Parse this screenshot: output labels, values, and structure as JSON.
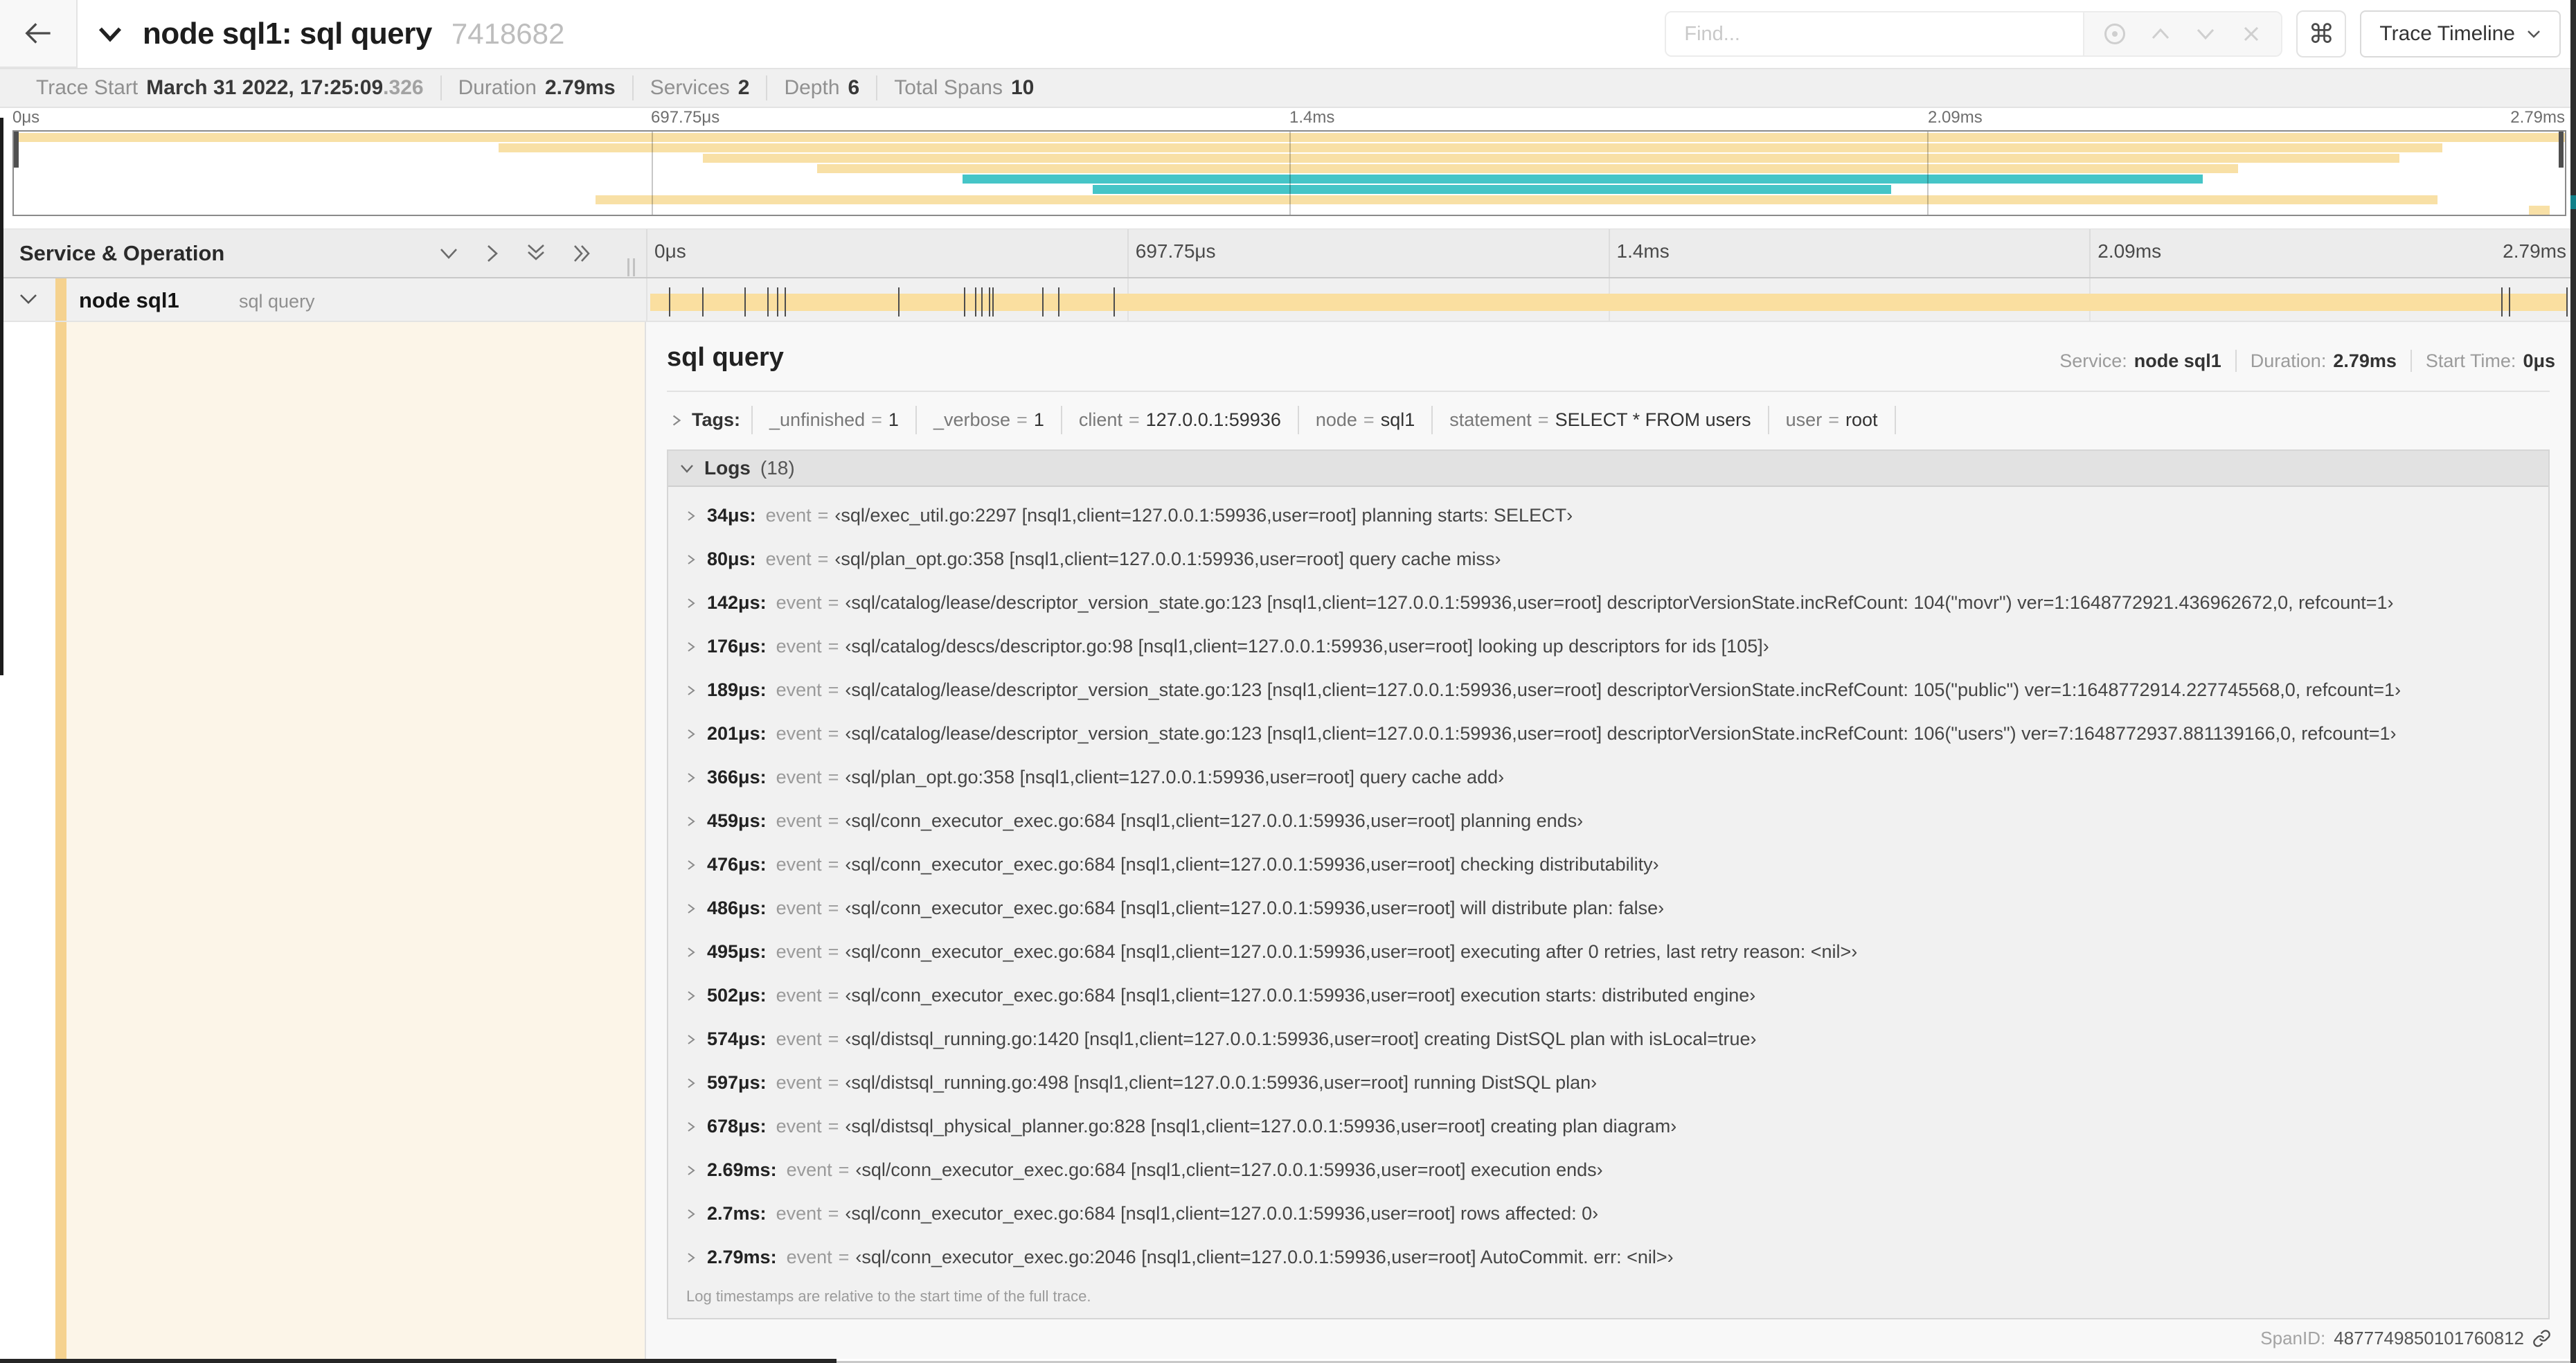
{
  "header": {
    "back_label": "back",
    "title": "node sql1: sql query",
    "trace_id": "7418682",
    "find_placeholder": "Find...",
    "shortcut_key": "⌘",
    "view_selector": "Trace Timeline"
  },
  "infobar": [
    {
      "label": "Trace Start",
      "value": "March 31 2022, 17:25:09",
      "suffix": ".326"
    },
    {
      "label": "Duration",
      "value": "2.79ms"
    },
    {
      "label": "Services",
      "value": "2"
    },
    {
      "label": "Depth",
      "value": "6"
    },
    {
      "label": "Total Spans",
      "value": "10"
    }
  ],
  "timeline": {
    "service_op_label": "Service & Operation",
    "ruler": [
      "0μs",
      "697.75μs",
      "1.4ms",
      "2.09ms",
      "2.79ms"
    ]
  },
  "minimap": {
    "bars": [
      {
        "s": 0,
        "e": 100,
        "c": "tan"
      },
      {
        "s": 19.0,
        "e": 95.2,
        "c": "tan"
      },
      {
        "s": 27.0,
        "e": 93.5,
        "c": "tan"
      },
      {
        "s": 31.5,
        "e": 87.2,
        "c": "tan"
      },
      {
        "s": 37.2,
        "e": 85.8,
        "c": "teal"
      },
      {
        "s": 42.3,
        "e": 73.6,
        "c": "teal"
      },
      {
        "s": 22.8,
        "e": 95.0,
        "c": "tan"
      },
      {
        "s": 98.6,
        "e": 99.4,
        "c": "tan"
      }
    ]
  },
  "span": {
    "service": "node sql1",
    "operation": "sql query",
    "ticks": [
      {
        "pct": 1.2
      },
      {
        "pct": 2.9
      },
      {
        "pct": 5.1
      },
      {
        "pct": 6.3
      },
      {
        "pct": 6.8
      },
      {
        "pct": 7.2
      },
      {
        "pct": 13.1
      },
      {
        "pct": 16.5
      },
      {
        "pct": 17.1
      },
      {
        "pct": 17.4
      },
      {
        "pct": 17.8
      },
      {
        "pct": 18.0
      },
      {
        "pct": 20.6
      },
      {
        "pct": 21.4
      },
      {
        "pct": 24.3
      },
      {
        "pct": 96.4
      },
      {
        "pct": 96.8
      },
      {
        "pct": 99.8
      }
    ]
  },
  "detail": {
    "title": "sql query",
    "equals": "=",
    "meta": [
      {
        "label": "Service:",
        "value": "node sql1"
      },
      {
        "label": "Duration:",
        "value": "2.79ms"
      },
      {
        "label": "Start Time:",
        "value": "0μs"
      }
    ],
    "tags_label": "Tags:",
    "tags": [
      {
        "key": "_unfinished",
        "value": "1"
      },
      {
        "key": "_verbose",
        "value": "1"
      },
      {
        "key": "client",
        "value": "127.0.0.1:59936"
      },
      {
        "key": "node",
        "value": "sql1"
      },
      {
        "key": "statement",
        "value": "SELECT * FROM users"
      },
      {
        "key": "user",
        "value": "root"
      }
    ],
    "logs_label": "Logs",
    "logs_count": "(18)",
    "logs": [
      {
        "t": "34μs:",
        "key": "event",
        "value": "‹sql/exec_util.go:2297 [nsql1,client=127.0.0.1:59936,user=root] planning starts: SELECT›"
      },
      {
        "t": "80μs:",
        "key": "event",
        "value": "‹sql/plan_opt.go:358 [nsql1,client=127.0.0.1:59936,user=root] query cache miss›"
      },
      {
        "t": "142μs:",
        "key": "event",
        "value": "‹sql/catalog/lease/descriptor_version_state.go:123 [nsql1,client=127.0.0.1:59936,user=root] descriptorVersionState.incRefCount: 104(\"movr\") ver=1:1648772921.436962672,0, refcount=1›"
      },
      {
        "t": "176μs:",
        "key": "event",
        "value": "‹sql/catalog/descs/descriptor.go:98 [nsql1,client=127.0.0.1:59936,user=root] looking up descriptors for ids [105]›"
      },
      {
        "t": "189μs:",
        "key": "event",
        "value": "‹sql/catalog/lease/descriptor_version_state.go:123 [nsql1,client=127.0.0.1:59936,user=root] descriptorVersionState.incRefCount: 105(\"public\") ver=1:1648772914.227745568,0, refcount=1›"
      },
      {
        "t": "201μs:",
        "key": "event",
        "value": "‹sql/catalog/lease/descriptor_version_state.go:123 [nsql1,client=127.0.0.1:59936,user=root] descriptorVersionState.incRefCount: 106(\"users\") ver=7:1648772937.881139166,0, refcount=1›"
      },
      {
        "t": "366μs:",
        "key": "event",
        "value": "‹sql/plan_opt.go:358 [nsql1,client=127.0.0.1:59936,user=root] query cache add›"
      },
      {
        "t": "459μs:",
        "key": "event",
        "value": "‹sql/conn_executor_exec.go:684 [nsql1,client=127.0.0.1:59936,user=root] planning ends›"
      },
      {
        "t": "476μs:",
        "key": "event",
        "value": "‹sql/conn_executor_exec.go:684 [nsql1,client=127.0.0.1:59936,user=root] checking distributability›"
      },
      {
        "t": "486μs:",
        "key": "event",
        "value": "‹sql/conn_executor_exec.go:684 [nsql1,client=127.0.0.1:59936,user=root] will distribute plan: false›"
      },
      {
        "t": "495μs:",
        "key": "event",
        "value": "‹sql/conn_executor_exec.go:684 [nsql1,client=127.0.0.1:59936,user=root] executing after 0 retries, last retry reason: <nil>›"
      },
      {
        "t": "502μs:",
        "key": "event",
        "value": "‹sql/conn_executor_exec.go:684 [nsql1,client=127.0.0.1:59936,user=root] execution starts: distributed engine›"
      },
      {
        "t": "574μs:",
        "key": "event",
        "value": "‹sql/distsql_running.go:1420 [nsql1,client=127.0.0.1:59936,user=root] creating DistSQL plan with isLocal=true›"
      },
      {
        "t": "597μs:",
        "key": "event",
        "value": "‹sql/distsql_running.go:498 [nsql1,client=127.0.0.1:59936,user=root] running DistSQL plan›"
      },
      {
        "t": "678μs:",
        "key": "event",
        "value": "‹sql/distsql_physical_planner.go:828 [nsql1,client=127.0.0.1:59936,user=root] creating plan diagram›"
      },
      {
        "t": "2.69ms:",
        "key": "event",
        "value": "‹sql/conn_executor_exec.go:684 [nsql1,client=127.0.0.1:59936,user=root] execution ends›"
      },
      {
        "t": "2.7ms:",
        "key": "event",
        "value": "‹sql/conn_executor_exec.go:684 [nsql1,client=127.0.0.1:59936,user=root] rows affected: 0›"
      },
      {
        "t": "2.79ms:",
        "key": "event",
        "value": "‹sql/conn_executor_exec.go:2046 [nsql1,client=127.0.0.1:59936,user=root] AutoCommit. err: <nil>›"
      }
    ],
    "note": "Log timestamps are relative to the start time of the full trace.",
    "footer_label": "SpanID:",
    "footer_value": "4877749850101760812"
  },
  "colors": {
    "tan_bar": "#F8E0A6",
    "tan_stripe": "#F5D28F",
    "teal": "#45C5C7",
    "cream": "#FCF5E8"
  }
}
